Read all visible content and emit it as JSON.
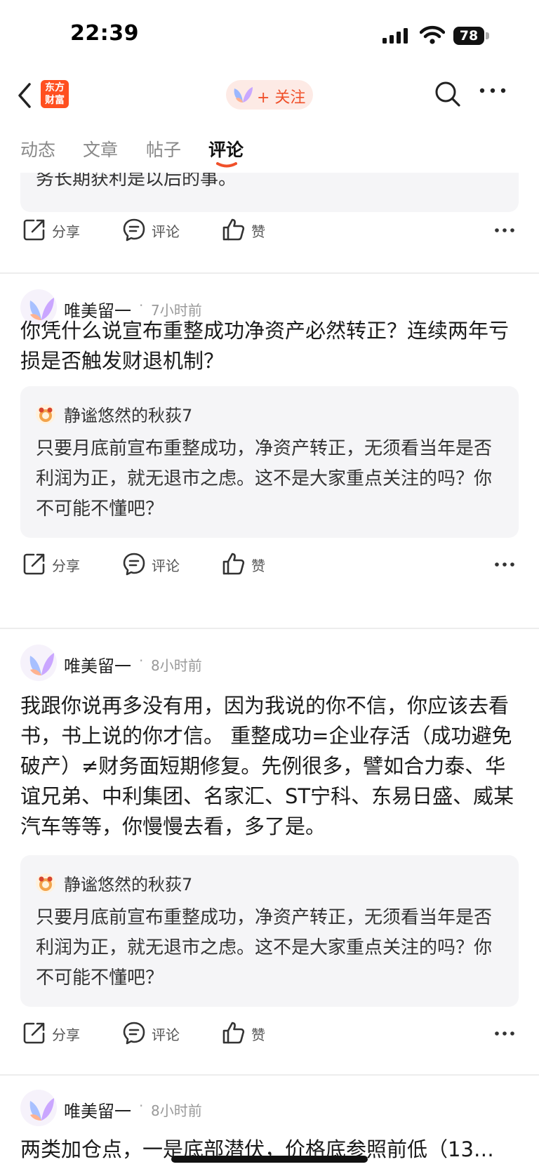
{
  "status_bar": {
    "time": "22:39",
    "battery": "78"
  },
  "nav": {
    "logo_line1": "东方",
    "logo_line2": "财富",
    "follow_label": "+ 关注"
  },
  "tabs": [
    {
      "label": "动态"
    },
    {
      "label": "文章"
    },
    {
      "label": "帖子"
    },
    {
      "label": "评论",
      "active": true
    }
  ],
  "top_fragment": {
    "quote_text": "务长期获利是以后的事。",
    "actions": {
      "share": "分享",
      "comment": "评论",
      "like": "赞"
    }
  },
  "posts": [
    {
      "author": "唯美留一",
      "time_ago": "7小时前",
      "text": "你凭什么说宣布重整成功净资产必然转正？连续两年亏损是否触发财退机制？",
      "quote": {
        "user": "静谧悠然的秋荻7",
        "text": "只要月底前宣布重整成功，净资产转正，无须看当年是否利润为正，就无退市之虑。这不是大家重点关注的吗？你不可能不懂吧？"
      },
      "actions": {
        "share": "分享",
        "comment": "评论",
        "like": "赞"
      }
    },
    {
      "author": "唯美留一",
      "time_ago": "8小时前",
      "text": "我跟你说再多没有用，因为我说的你不信，你应该去看书，书上说的你才信。  重整成功=企业存活（成功避免破产）≠财务面短期修复。先例很多，譬如合力泰、华谊兄弟、中利集团、名家汇、ST宁科、东易日盛、威某汽车等等，你慢慢去看，多了是。",
      "quote": {
        "user": "静谧悠然的秋荻7",
        "text": "只要月底前宣布重整成功，净资产转正，无须看当年是否利润为正，就无退市之虑。这不是大家重点关注的吗？你不可能不懂吧？"
      },
      "actions": {
        "share": "分享",
        "comment": "评论",
        "like": "赞"
      }
    },
    {
      "author": "唯美留一",
      "time_ago": "8小时前",
      "text": "两类加仓点，一是底部潜伏，价格底参照前低（13…"
    }
  ],
  "colors": {
    "accent": "#f0502a",
    "logo": "#ff4f1f",
    "quote_bg": "#f5f5f7"
  }
}
